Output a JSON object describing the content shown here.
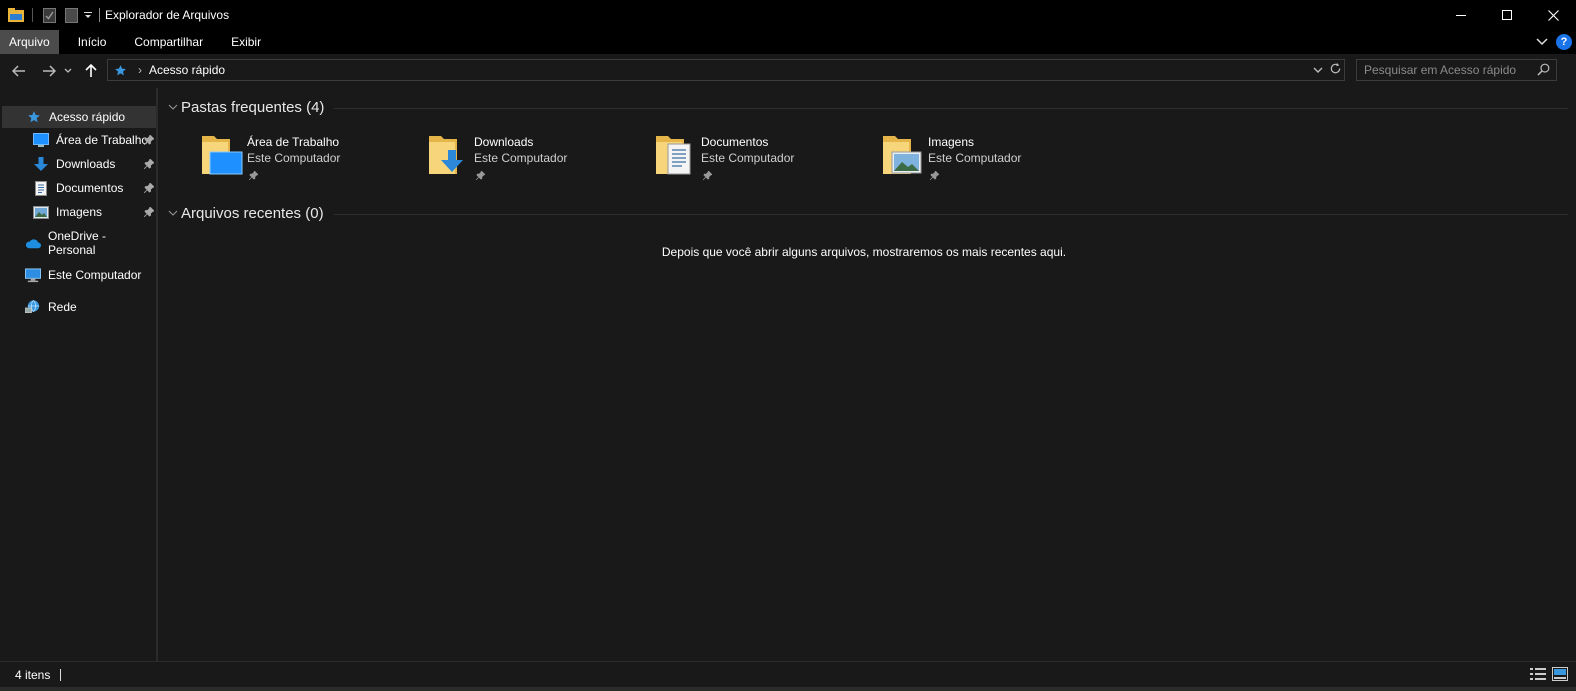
{
  "window": {
    "title": "Explorador de Arquivos",
    "controls": [
      "minimize",
      "maximize",
      "close"
    ]
  },
  "ribbon": {
    "tabs": [
      {
        "label": "Arquivo",
        "active": true
      },
      {
        "label": "Início",
        "active": false
      },
      {
        "label": "Compartilhar",
        "active": false
      },
      {
        "label": "Exibir",
        "active": false
      }
    ],
    "help_label": "?"
  },
  "address": {
    "breadcrumb": "Acesso rápido",
    "separator": "›"
  },
  "search": {
    "placeholder": "Pesquisar em Acesso rápido"
  },
  "navpane": {
    "quick_access": "Acesso rápido",
    "pinned": [
      {
        "label": "Área de Trabalho",
        "icon": "desktop-icon"
      },
      {
        "label": "Downloads",
        "icon": "download-icon"
      },
      {
        "label": "Documentos",
        "icon": "document-icon"
      },
      {
        "label": "Imagens",
        "icon": "pictures-icon"
      }
    ],
    "onedrive": "OneDrive - Personal",
    "this_pc": "Este Computador",
    "network": "Rede"
  },
  "content": {
    "frequent_header": "Pastas frequentes (4)",
    "recent_header": "Arquivos recentes (0)",
    "folders": [
      {
        "name": "Área de Trabalho",
        "location": "Este Computador",
        "overlay": "desktop"
      },
      {
        "name": "Downloads",
        "location": "Este Computador",
        "overlay": "download"
      },
      {
        "name": "Documentos",
        "location": "Este Computador",
        "overlay": "document"
      },
      {
        "name": "Imagens",
        "location": "Este Computador",
        "overlay": "pictures"
      }
    ],
    "empty_recent_message": "Depois que você abrir alguns arquivos, mostraremos os mais recentes aqui."
  },
  "status": {
    "item_count": "4 itens"
  },
  "colors": {
    "accent_blue": "#3a96dd",
    "folder_yellow": "#f5c94f",
    "background": "#191919",
    "titlebar": "#000000"
  }
}
